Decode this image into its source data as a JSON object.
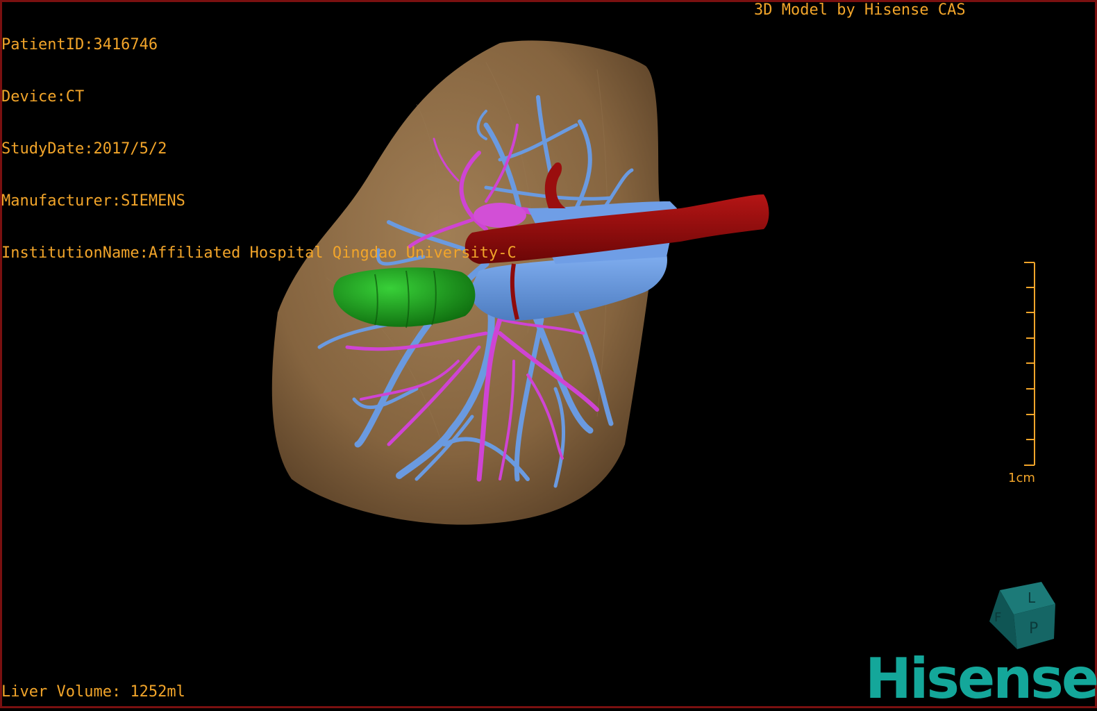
{
  "overlay": {
    "patient_id": "PatientID:3416746",
    "device": "Device:CT",
    "study_date": "StudyDate:2017/5/2",
    "manufacturer": "Manufacturer:SIEMENS",
    "institution": "InstitutionName:Affiliated Hospital Qingdao University-C",
    "title": "3D Model by Hisense CAS",
    "liver_volume": "Liver Volume: 1252ml"
  },
  "scale_bar": {
    "label": "1cm"
  },
  "brand": {
    "logo_text": "Hisense"
  },
  "colors": {
    "text": "#f2a52a",
    "liver": "#8c6a45",
    "portal_vein": "#5d8fd4",
    "hepatic_vessel": "#cc3fd0",
    "artery": "#8e0b0b",
    "gallbladder": "#1b9a1b",
    "brand": "#14a79a",
    "frame": "#7a1010"
  }
}
